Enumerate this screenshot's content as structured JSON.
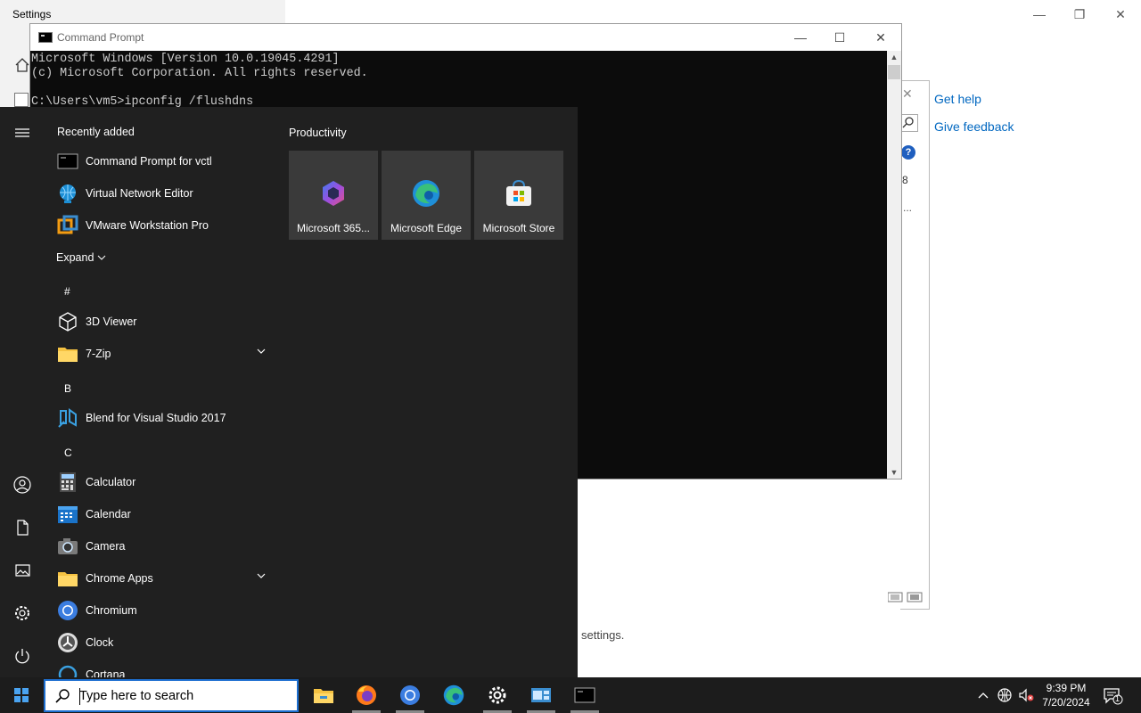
{
  "settings": {
    "title": "Settings",
    "get_help": "Get help",
    "give_feedback": "Give feedback",
    "footer_text": "settings."
  },
  "help_window": {
    "fragment_number": "8",
    "fragment_dots": "..."
  },
  "cmd": {
    "title": "Command Prompt",
    "lines": [
      "Microsoft Windows [Version 10.0.19045.4291]",
      "(c) Microsoft Corporation. All rights reserved.",
      "",
      "C:\\Users\\vm5>ipconfig /flushdns"
    ]
  },
  "start_menu": {
    "recently_added_header": "Recently added",
    "recent_apps": [
      {
        "label": "Command Prompt for vctl",
        "icon": "cmd-icon"
      },
      {
        "label": "Virtual Network Editor",
        "icon": "network-globe-icon"
      },
      {
        "label": "VMware Workstation Pro",
        "icon": "vmware-icon"
      }
    ],
    "expand_label": "Expand",
    "letters": {
      "hash": "#",
      "b": "B",
      "c": "C"
    },
    "apps_hash": [
      {
        "label": "3D Viewer",
        "icon": "cube-icon"
      },
      {
        "label": "7-Zip",
        "icon": "folder-icon"
      }
    ],
    "apps_b": [
      {
        "label": "Blend for Visual Studio 2017",
        "icon": "blend-icon"
      }
    ],
    "apps_c": [
      {
        "label": "Calculator",
        "icon": "calculator-icon"
      },
      {
        "label": "Calendar",
        "icon": "calendar-icon"
      },
      {
        "label": "Camera",
        "icon": "camera-icon"
      },
      {
        "label": "Chrome Apps",
        "icon": "folder-icon"
      },
      {
        "label": "Chromium",
        "icon": "chromium-icon"
      },
      {
        "label": "Clock",
        "icon": "clock-icon"
      },
      {
        "label": "Cortana",
        "icon": "cortana-icon"
      }
    ],
    "productivity_header": "Productivity",
    "tiles": [
      {
        "label": "Microsoft 365...",
        "icon": "microsoft-365-icon"
      },
      {
        "label": "Microsoft Edge",
        "icon": "edge-icon"
      },
      {
        "label": "Microsoft Store",
        "icon": "store-icon"
      }
    ]
  },
  "taskbar": {
    "search_placeholder": "Type here to search",
    "apps": [
      "File Explorer",
      "Firefox",
      "Chromium",
      "Microsoft Edge",
      "Settings",
      "Control Panel",
      "Command Prompt"
    ],
    "time": "9:39 PM",
    "date": "7/20/2024",
    "notification_count": "1"
  },
  "colors": {
    "start_bg": "#202020",
    "tile_bg": "#3a3a3a",
    "accent": "#1e6fd0",
    "link": "#0067c0"
  }
}
